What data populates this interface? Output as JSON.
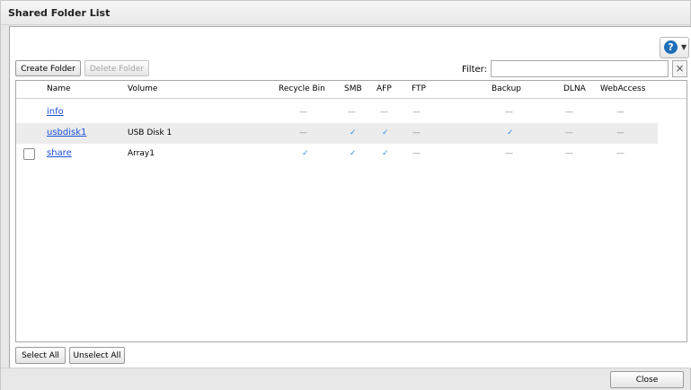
{
  "dialog": {
    "title": "Shared Folder List",
    "help_icon": "question-circle-icon"
  },
  "toolbar": {
    "create_folder": "Create Folder",
    "delete_folder": "Delete Folder",
    "filter_label": "Filter:",
    "filter_value": "",
    "clear_icon": "×"
  },
  "table": {
    "columns": [
      "Name",
      "Volume",
      "Recycle Bin",
      "SMB",
      "AFP",
      "FTP",
      "Backup",
      "DLNA",
      "WebAccess"
    ],
    "rows": [
      {
        "name": "info",
        "volume": "",
        "recycle": "—",
        "smb": "—",
        "afp": "—",
        "ftp": "—",
        "backup": "—",
        "dlna": "—",
        "webaccess": "—",
        "checkbox": false
      },
      {
        "name": "usbdisk1",
        "volume": "USB Disk 1",
        "recycle": "—",
        "smb": "✓",
        "afp": "✓",
        "ftp": "—",
        "backup": "✓",
        "dlna": "—",
        "webaccess": "—",
        "checkbox": false
      },
      {
        "name": "share",
        "volume": "Array1",
        "recycle": "✓",
        "smb": "✓",
        "afp": "✓",
        "ftp": "—",
        "backup": "—",
        "dlna": "—",
        "webaccess": "—",
        "checkbox": true
      }
    ]
  },
  "selection": {
    "select_all": "Select All",
    "unselect_all": "Unselect All"
  },
  "footer": {
    "close": "Close"
  },
  "colors": {
    "check": "#2c8fe6",
    "link": "#1a4fd8",
    "help": "#1e6fb8"
  }
}
